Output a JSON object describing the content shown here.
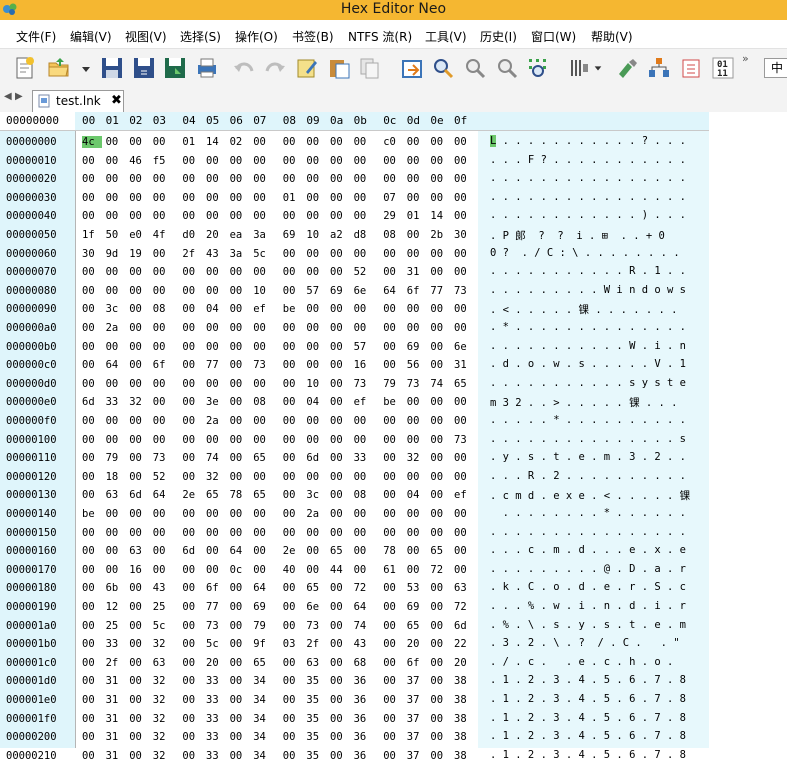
{
  "window": {
    "title": "Hex Editor Neo"
  },
  "menu": [
    "文件(F)",
    "编辑(V)",
    "视图(V)",
    "选择(S)",
    "操作(O)",
    "书签(B)",
    "NTFS 流(R)",
    "工具(V)",
    "历史(I)",
    "窗口(W)",
    "帮助(V)"
  ],
  "toolbar": {
    "more": "»",
    "lang": "中"
  },
  "tab": {
    "name": "test.lnk",
    "close": "✖",
    "nav_left": "◀",
    "nav_right": "▶"
  },
  "header": {
    "offset_label": "00000000",
    "columns": [
      "00",
      "01",
      "02",
      "03",
      "04",
      "05",
      "06",
      "07",
      "08",
      "09",
      "0a",
      "0b",
      "0c",
      "0d",
      "0e",
      "0f"
    ]
  },
  "rows": [
    {
      "addr": "00000000",
      "bytes": [
        "4c",
        "00",
        "00",
        "00",
        "01",
        "14",
        "02",
        "00",
        "00",
        "00",
        "00",
        "00",
        "c0",
        "00",
        "00",
        "00"
      ],
      "chars": "L . . . . . . . . . . . ? . . ."
    },
    {
      "addr": "00000010",
      "bytes": [
        "00",
        "00",
        "46",
        "f5",
        "00",
        "00",
        "00",
        "00",
        "00",
        "00",
        "00",
        "00",
        "00",
        "00",
        "00",
        "00"
      ],
      "chars": ". . . F ? . . . . . . . . . . ."
    },
    {
      "addr": "00000020",
      "bytes": [
        "00",
        "00",
        "00",
        "00",
        "00",
        "00",
        "00",
        "00",
        "00",
        "00",
        "00",
        "00",
        "00",
        "00",
        "00",
        "00"
      ],
      "chars": ". . . . . . . . . . . . . . . ."
    },
    {
      "addr": "00000030",
      "bytes": [
        "00",
        "00",
        "00",
        "00",
        "00",
        "00",
        "00",
        "00",
        "01",
        "00",
        "00",
        "00",
        "07",
        "00",
        "00",
        "00"
      ],
      "chars": ". . . . . . . . . . . . . . . ."
    },
    {
      "addr": "00000040",
      "bytes": [
        "00",
        "00",
        "00",
        "00",
        "00",
        "00",
        "00",
        "00",
        "00",
        "00",
        "00",
        "00",
        "29",
        "01",
        "14",
        "00"
      ],
      "chars": ". . . . . . . . . . . . ) . . ."
    },
    {
      "addr": "00000050",
      "bytes": [
        "1f",
        "50",
        "e0",
        "4f",
        "d0",
        "20",
        "ea",
        "3a",
        "69",
        "10",
        "a2",
        "d8",
        "08",
        "00",
        "2b",
        "30"
      ],
      "chars": ". P 郞  ?  ?  i . ⊞  . . + 0"
    },
    {
      "addr": "00000060",
      "bytes": [
        "30",
        "9d",
        "19",
        "00",
        "2f",
        "43",
        "3a",
        "5c",
        "00",
        "00",
        "00",
        "00",
        "00",
        "00",
        "00",
        "00"
      ],
      "chars": "0 ?  . / C : \\ . . . . . . . ."
    },
    {
      "addr": "00000070",
      "bytes": [
        "00",
        "00",
        "00",
        "00",
        "00",
        "00",
        "00",
        "00",
        "00",
        "00",
        "00",
        "52",
        "00",
        "31",
        "00",
        "00"
      ],
      "chars": ". . . . . . . . . . . R . 1 . ."
    },
    {
      "addr": "00000080",
      "bytes": [
        "00",
        "00",
        "00",
        "00",
        "00",
        "00",
        "00",
        "10",
        "00",
        "57",
        "69",
        "6e",
        "64",
        "6f",
        "77",
        "73"
      ],
      "chars": ". . . . . . . . . W i n d o w s"
    },
    {
      "addr": "00000090",
      "bytes": [
        "00",
        "3c",
        "00",
        "08",
        "00",
        "04",
        "00",
        "ef",
        "be",
        "00",
        "00",
        "00",
        "00",
        "00",
        "00",
        "00"
      ],
      "chars": ". < . . . . . 锞 . . . . . . ."
    },
    {
      "addr": "000000a0",
      "bytes": [
        "00",
        "2a",
        "00",
        "00",
        "00",
        "00",
        "00",
        "00",
        "00",
        "00",
        "00",
        "00",
        "00",
        "00",
        "00",
        "00"
      ],
      "chars": ". * . . . . . . . . . . . . . ."
    },
    {
      "addr": "000000b0",
      "bytes": [
        "00",
        "00",
        "00",
        "00",
        "00",
        "00",
        "00",
        "00",
        "00",
        "00",
        "00",
        "57",
        "00",
        "69",
        "00",
        "6e"
      ],
      "chars": ". . . . . . . . . . . W . i . n"
    },
    {
      "addr": "000000c0",
      "bytes": [
        "00",
        "64",
        "00",
        "6f",
        "00",
        "77",
        "00",
        "73",
        "00",
        "00",
        "00",
        "16",
        "00",
        "56",
        "00",
        "31"
      ],
      "chars": ". d . o . w . s . . . . . V . 1"
    },
    {
      "addr": "000000d0",
      "bytes": [
        "00",
        "00",
        "00",
        "00",
        "00",
        "00",
        "00",
        "00",
        "00",
        "10",
        "00",
        "73",
        "79",
        "73",
        "74",
        "65"
      ],
      "chars": ". . . . . . . . . . . s y s t e"
    },
    {
      "addr": "000000e0",
      "bytes": [
        "6d",
        "33",
        "32",
        "00",
        "00",
        "3e",
        "00",
        "08",
        "00",
        "04",
        "00",
        "ef",
        "be",
        "00",
        "00",
        "00"
      ],
      "chars": "m 3 2 . . > . . . . . 锞 . . ."
    },
    {
      "addr": "000000f0",
      "bytes": [
        "00",
        "00",
        "00",
        "00",
        "00",
        "2a",
        "00",
        "00",
        "00",
        "00",
        "00",
        "00",
        "00",
        "00",
        "00",
        "00"
      ],
      "chars": ". . . . . * . . . . . . . . . ."
    },
    {
      "addr": "00000100",
      "bytes": [
        "00",
        "00",
        "00",
        "00",
        "00",
        "00",
        "00",
        "00",
        "00",
        "00",
        "00",
        "00",
        "00",
        "00",
        "00",
        "73"
      ],
      "chars": ". . . . . . . . . . . . . . . s"
    },
    {
      "addr": "00000110",
      "bytes": [
        "00",
        "79",
        "00",
        "73",
        "00",
        "74",
        "00",
        "65",
        "00",
        "6d",
        "00",
        "33",
        "00",
        "32",
        "00",
        "00"
      ],
      "chars": ". y . s . t . e . m . 3 . 2 . ."
    },
    {
      "addr": "00000120",
      "bytes": [
        "00",
        "18",
        "00",
        "52",
        "00",
        "32",
        "00",
        "00",
        "00",
        "00",
        "00",
        "00",
        "00",
        "00",
        "00",
        "00"
      ],
      "chars": ". . . R . 2 . . . . . . . . . ."
    },
    {
      "addr": "00000130",
      "bytes": [
        "00",
        "63",
        "6d",
        "64",
        "2e",
        "65",
        "78",
        "65",
        "00",
        "3c",
        "00",
        "08",
        "00",
        "04",
        "00",
        "ef"
      ],
      "chars": ". c m d . e x e . < . . . . . 锞"
    },
    {
      "addr": "00000140",
      "bytes": [
        "be",
        "00",
        "00",
        "00",
        "00",
        "00",
        "00",
        "00",
        "00",
        "2a",
        "00",
        "00",
        "00",
        "00",
        "00",
        "00"
      ],
      "chars": "  . . . . . . . . * . . . . . ."
    },
    {
      "addr": "00000150",
      "bytes": [
        "00",
        "00",
        "00",
        "00",
        "00",
        "00",
        "00",
        "00",
        "00",
        "00",
        "00",
        "00",
        "00",
        "00",
        "00",
        "00"
      ],
      "chars": ". . . . . . . . . . . . . . . ."
    },
    {
      "addr": "00000160",
      "bytes": [
        "00",
        "00",
        "63",
        "00",
        "6d",
        "00",
        "64",
        "00",
        "2e",
        "00",
        "65",
        "00",
        "78",
        "00",
        "65",
        "00"
      ],
      "chars": ". . . c . m . d . . . e . x . e"
    },
    {
      "addr": "00000170",
      "bytes": [
        "00",
        "00",
        "16",
        "00",
        "00",
        "00",
        "0c",
        "00",
        "40",
        "00",
        "44",
        "00",
        "61",
        "00",
        "72",
        "00"
      ],
      "chars": ". . . . . . . . . @ . D . a . r"
    },
    {
      "addr": "00000180",
      "bytes": [
        "00",
        "6b",
        "00",
        "43",
        "00",
        "6f",
        "00",
        "64",
        "00",
        "65",
        "00",
        "72",
        "00",
        "53",
        "00",
        "63"
      ],
      "chars": ". k . C . o . d . e . r . S . c"
    },
    {
      "addr": "00000190",
      "bytes": [
        "00",
        "12",
        "00",
        "25",
        "00",
        "77",
        "00",
        "69",
        "00",
        "6e",
        "00",
        "64",
        "00",
        "69",
        "00",
        "72"
      ],
      "chars": ". . . % . w . i . n . d . i . r"
    },
    {
      "addr": "000001a0",
      "bytes": [
        "00",
        "25",
        "00",
        "5c",
        "00",
        "73",
        "00",
        "79",
        "00",
        "73",
        "00",
        "74",
        "00",
        "65",
        "00",
        "6d"
      ],
      "chars": ". % . \\ . s . y . s . t . e . m"
    },
    {
      "addr": "000001b0",
      "bytes": [
        "00",
        "33",
        "00",
        "32",
        "00",
        "5c",
        "00",
        "9f",
        "03",
        "2f",
        "00",
        "43",
        "00",
        "20",
        "00",
        "22"
      ],
      "chars": ". 3 . 2 . \\ . ?  / . C .   . \""
    },
    {
      "addr": "000001c0",
      "bytes": [
        "00",
        "2f",
        "00",
        "63",
        "00",
        "20",
        "00",
        "65",
        "00",
        "63",
        "00",
        "68",
        "00",
        "6f",
        "00",
        "20"
      ],
      "chars": ". / . c .   . e . c . h . o .  "
    },
    {
      "addr": "000001d0",
      "bytes": [
        "00",
        "31",
        "00",
        "32",
        "00",
        "33",
        "00",
        "34",
        "00",
        "35",
        "00",
        "36",
        "00",
        "37",
        "00",
        "38"
      ],
      "chars": ". 1 . 2 . 3 . 4 . 5 . 6 . 7 . 8"
    },
    {
      "addr": "000001e0",
      "bytes": [
        "00",
        "31",
        "00",
        "32",
        "00",
        "33",
        "00",
        "34",
        "00",
        "35",
        "00",
        "36",
        "00",
        "37",
        "00",
        "38"
      ],
      "chars": ". 1 . 2 . 3 . 4 . 5 . 6 . 7 . 8"
    },
    {
      "addr": "000001f0",
      "bytes": [
        "00",
        "31",
        "00",
        "32",
        "00",
        "33",
        "00",
        "34",
        "00",
        "35",
        "00",
        "36",
        "00",
        "37",
        "00",
        "38"
      ],
      "chars": ". 1 . 2 . 3 . 4 . 5 . 6 . 7 . 8"
    },
    {
      "addr": "00000200",
      "bytes": [
        "00",
        "31",
        "00",
        "32",
        "00",
        "33",
        "00",
        "34",
        "00",
        "35",
        "00",
        "36",
        "00",
        "37",
        "00",
        "38"
      ],
      "chars": ". 1 . 2 . 3 . 4 . 5 . 6 . 7 . 8"
    },
    {
      "addr": "00000210",
      "bytes": [
        "00",
        "31",
        "00",
        "32",
        "00",
        "33",
        "00",
        "34",
        "00",
        "35",
        "00",
        "36",
        "00",
        "37",
        "00",
        "38"
      ],
      "chars": ". 1 . 2 . 3 . 4 . 5 . 6 . 7 . 8"
    }
  ],
  "selection": {
    "row": 0,
    "col": 0
  },
  "colors": {
    "titlebar": "#f5b731",
    "selection": "#6cc86c",
    "panel": "#dff5fb"
  }
}
